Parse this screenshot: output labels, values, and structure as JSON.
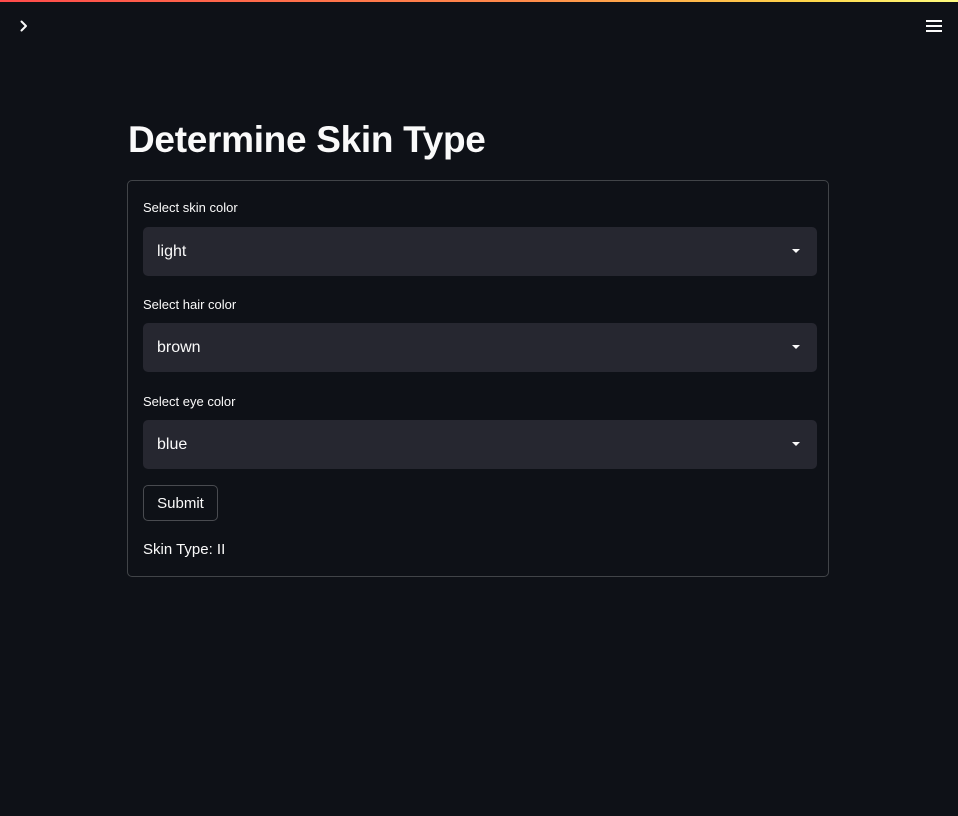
{
  "header": {
    "sidebar_toggle_icon": "chevron-right-icon",
    "menu_icon": "hamburger-menu-icon",
    "accent_gradient": [
      "#ff4b4b",
      "#ffd84b",
      "#fffd80"
    ]
  },
  "main": {
    "title": "Determine Skin Type",
    "form": {
      "fields": [
        {
          "label": "Select skin color",
          "value": "light"
        },
        {
          "label": "Select hair color",
          "value": "brown"
        },
        {
          "label": "Select eye color",
          "value": "blue"
        }
      ],
      "submit_label": "Submit",
      "result_text": "Skin Type: II"
    }
  },
  "colors": {
    "background": "#0e1117",
    "select_background": "#262730",
    "text": "#fafafa"
  }
}
